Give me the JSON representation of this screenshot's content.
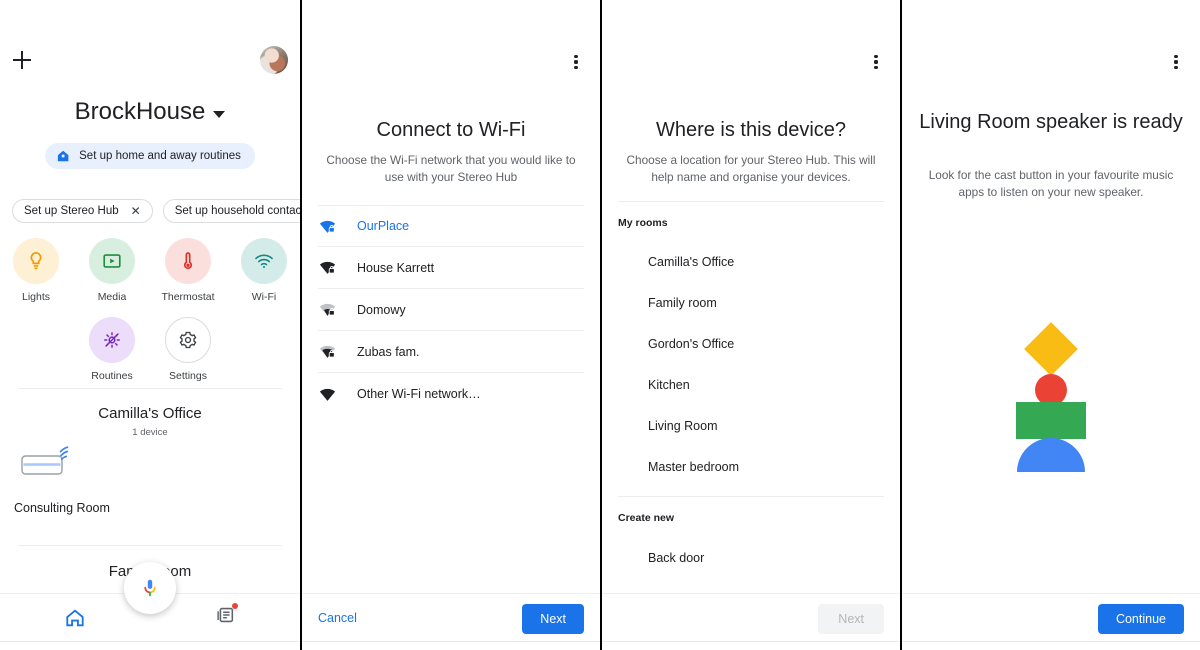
{
  "panels": {
    "home": {
      "add_icon": "plus-icon",
      "avatar": "account-avatar",
      "title": "BrockHouse",
      "routines_chip": "Set up home and away routines",
      "chips": [
        {
          "label": "Set up Stereo Hub",
          "close": "✕"
        },
        {
          "label": "Set up household contacts",
          "close": "✕"
        }
      ],
      "tiles_row1": [
        {
          "label": "Lights",
          "icon": "lightbulb-icon",
          "bg": "#fdf0d5",
          "fg": "#f29900"
        },
        {
          "label": "Media",
          "icon": "media-play-icon",
          "bg": "#d8efdf",
          "fg": "#1e8e3e"
        },
        {
          "label": "Thermostat",
          "icon": "thermometer-icon",
          "bg": "#fbdfdd",
          "fg": "#d93025"
        },
        {
          "label": "Wi-Fi",
          "icon": "wifi-icon",
          "bg": "#d3ecea",
          "fg": "#12897f"
        }
      ],
      "tiles_row2": [
        {
          "label": "Routines",
          "icon": "routines-icon",
          "bg": "#ecddfa",
          "fg": "#7627bb"
        },
        {
          "label": "Settings",
          "icon": "gear-icon",
          "bg": "#ffffff",
          "fg": "#3c4043"
        }
      ],
      "room1": {
        "name": "Camilla's Office",
        "count": "1 device",
        "device": "Consulting Room",
        "device_icon": "smart-display-icon"
      },
      "room2": {
        "name": "Family room"
      },
      "bottom_nav": [
        {
          "label": "home-tab",
          "icon": "home-icon"
        },
        {
          "label": "feed-tab",
          "icon": "feed-icon"
        }
      ],
      "mic_fab": "assistant-mic-icon"
    },
    "wifi": {
      "title": "Connect to Wi-Fi",
      "subtitle": "Choose the Wi-Fi network that you would like to use with your Stereo Hub",
      "networks": [
        {
          "name": "OurPlace",
          "icon": "wifi-lock-strong-icon",
          "selected": true,
          "strength": "strong",
          "secured": true
        },
        {
          "name": "House Karrett",
          "icon": "wifi-lock-strong-icon",
          "selected": false,
          "strength": "strong",
          "secured": true
        },
        {
          "name": "Domowy",
          "icon": "wifi-lock-weak-icon",
          "selected": false,
          "strength": "weak",
          "secured": true
        },
        {
          "name": "Zubas fam.",
          "icon": "wifi-lock-medium-icon",
          "selected": false,
          "strength": "medium",
          "secured": true
        },
        {
          "name": "Other Wi-Fi network…",
          "icon": "wifi-icon",
          "selected": false,
          "strength": "strong",
          "secured": false
        }
      ],
      "cancel_label": "Cancel",
      "next_label": "Next"
    },
    "location": {
      "title": "Where is this device?",
      "subtitle": "Choose a location for your Stereo Hub. This will help name and organise your devices.",
      "my_rooms_header": "My rooms",
      "rooms": [
        "Camilla's Office",
        "Family room",
        "Gordon's Office",
        "Kitchen",
        "Living Room",
        "Master bedroom"
      ],
      "create_new_header": "Create new",
      "create_new_items": [
        "Back door"
      ],
      "next_label": "Next",
      "next_disabled": true
    },
    "ready": {
      "title": "Living Room speaker is ready",
      "subtitle": "Look for the cast button in your favourite music apps to listen on your new speaker.",
      "illustration": {
        "diamond_color": "#f9bc15",
        "circle_color": "#ea4335",
        "rect_color": "#34a853",
        "dome_color": "#4285f4"
      },
      "continue_label": "Continue"
    }
  },
  "colors": {
    "accent_blue": "#1a73e8",
    "text_primary": "#202124",
    "text_secondary": "#5f6368",
    "divider": "#ededed",
    "chip_bg": "#e8f0fe"
  }
}
